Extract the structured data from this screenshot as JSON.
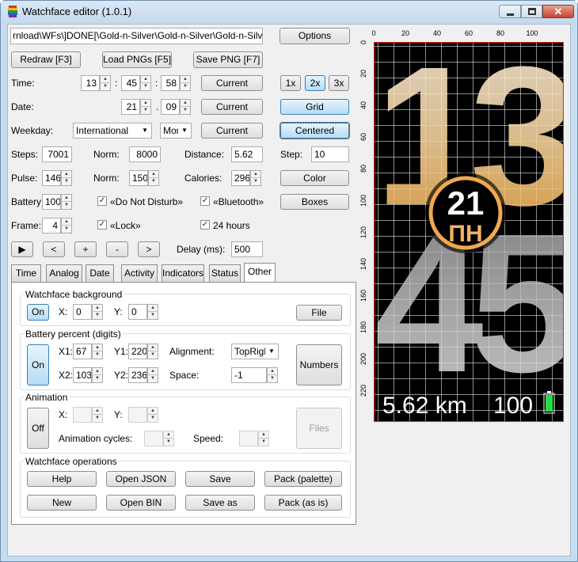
{
  "window": {
    "title": "Watchface editor (1.0.1)"
  },
  "file_path": "rnload\\WFs\\]DONE[\\Gold-n-Silver\\Gold-n-Silver\\Gold-n-Silver.json",
  "buttons": {
    "options": "Options",
    "redraw": "Redraw [F3]",
    "load_pngs": "Load PNGs [F5]",
    "save_png": "Save PNG [F7]",
    "current": "Current",
    "zoom_1x": "1x",
    "zoom_2x": "2x",
    "zoom_3x": "3x",
    "grid": "Grid",
    "centered": "Centered",
    "color": "Color",
    "boxes": "Boxes",
    "play": "▶",
    "prev": "<",
    "plus": "+",
    "minus": "-",
    "next": ">"
  },
  "time": {
    "label": "Time:",
    "hours": "13",
    "minutes": "45",
    "seconds": "58",
    "sep": ":"
  },
  "date": {
    "label": "Date:",
    "day": "21",
    "month": "09",
    "sep": "."
  },
  "weekday": {
    "label": "Weekday:",
    "mode": "International",
    "day": "Mon"
  },
  "steps": {
    "label": "Steps:",
    "value": "7001",
    "norm_label": "Norm:",
    "norm": "8000",
    "distance_label": "Distance:",
    "distance": "5.62",
    "step_label": "Step:",
    "step": "10"
  },
  "pulse": {
    "label": "Pulse:",
    "value": "146",
    "norm_label": "Norm:",
    "norm": "150",
    "calories_label": "Calories:",
    "calories": "296"
  },
  "battery": {
    "label": "Battery:",
    "value": "100",
    "dnd": "«Do Not Disturb»",
    "bluetooth": "«Bluetooth»"
  },
  "frame": {
    "label": "Frame:",
    "value": "4",
    "lock": "«Lock»",
    "hours24": "24 hours"
  },
  "delay": {
    "label": "Delay (ms):",
    "value": "500"
  },
  "tabs": [
    "Time",
    "Analog",
    "Date",
    "Activity",
    "Indicators",
    "Status",
    "Other"
  ],
  "bg": {
    "title": "Watchface background",
    "on": "On",
    "x_label": "X:",
    "x": "0",
    "y_label": "Y:",
    "y": "0",
    "file": "File"
  },
  "battery_digits": {
    "title": "Battery percent (digits)",
    "on": "On",
    "x1_label": "X1:",
    "x1": "67",
    "y1_label": "Y1:",
    "y1": "220",
    "x2_label": "X2:",
    "x2": "103",
    "y2_label": "Y2:",
    "y2": "236",
    "align_label": "Alignment:",
    "align": "TopRight",
    "space_label": "Space:",
    "space": "-1",
    "numbers": "Numbers"
  },
  "animation": {
    "title": "Animation",
    "off": "Off",
    "x_label": "X:",
    "y_label": "Y:",
    "cycles_label": "Animation cycles:",
    "speed_label": "Speed:",
    "files": "Files"
  },
  "ops": {
    "title": "Watchface operations",
    "help": "Help",
    "open_json": "Open JSON",
    "save": "Save",
    "pack_palette": "Pack (palette)",
    "new": "New",
    "open_bin": "Open BIN",
    "save_as": "Save as",
    "pack_as_is": "Pack (as is)"
  },
  "preview": {
    "x_ticks": [
      "0",
      "20",
      "40",
      "60",
      "80",
      "100"
    ],
    "y_ticks": [
      "0",
      "20",
      "40",
      "60",
      "80",
      "100",
      "120",
      "140",
      "160",
      "180",
      "200",
      "220"
    ],
    "hours": "13",
    "minutes": "45",
    "day": "21",
    "weekday": "ПН",
    "distance": "5.62 km",
    "battery": "100"
  },
  "colors": {
    "accent_gold": "#f5b860",
    "silver": "#c8c8c8",
    "battery_green": "#22dd44"
  }
}
